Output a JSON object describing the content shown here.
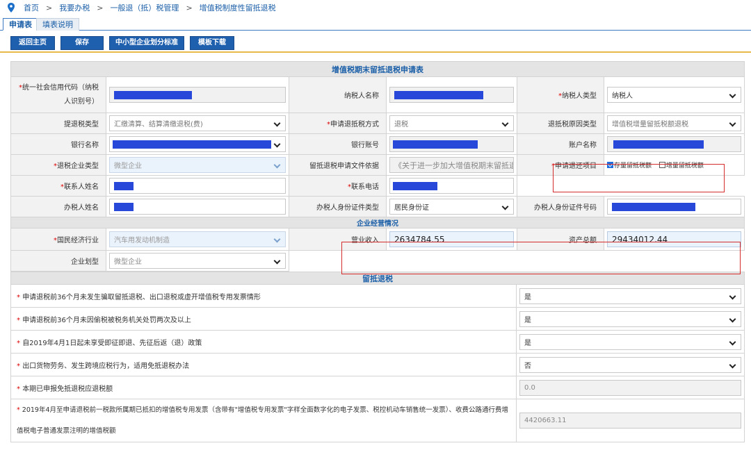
{
  "breadcrumb": {
    "items": [
      "首页",
      "我要办税",
      "一般退（抵）税管理",
      "增值税制度性留抵退税"
    ],
    "sep": ">"
  },
  "tabs": [
    "申请表",
    "填表说明"
  ],
  "toolbar": {
    "back": "返回主页",
    "save": "保存",
    "standard": "中小型企业划分标准",
    "template": "模板下载"
  },
  "form": {
    "title": "增值税期末留抵退税申请表",
    "credit_code_label": "统一社会信用代码（纳税人识别号）",
    "taxpayer_name_label": "纳税人名称",
    "taxpayer_type_label": "纳税人类型",
    "taxpayer_type_value": "纳税人",
    "refund_tax_type_label": "提退税类型",
    "refund_tax_type_value": "汇缴清算、结算清缴退税(费)",
    "refund_method_label": "申请退抵税方式",
    "refund_method_value": "退税",
    "refund_reason_label": "退抵税原因类型",
    "refund_reason_value": "增值税增量留抵税额退税",
    "bank_name_label": "银行名称",
    "bank_account_label": "银行账号",
    "account_name_label": "账户名称",
    "enterprise_type_label": "退税企业类型",
    "enterprise_type_value": "微型企业",
    "doc_basis_label": "留抵退税申请文件依据",
    "doc_basis_value": "《关于进一步加大增值税期末留抵退",
    "refund_item_label": "申请退还项目",
    "refund_item_opt1": "存量留抵税额",
    "refund_item_opt2": "增量留抵税额",
    "contact_name_label": "联系人姓名",
    "contact_phone_label": "联系电话",
    "handler_name_label": "办税人姓名",
    "handler_id_type_label": "办税人身份证件类型",
    "handler_id_type_value": "居民身份证",
    "handler_id_no_label": "办税人身份证件号码",
    "section_business": "企业经营情况",
    "industry_label": "国民经济行业",
    "industry_value": "汽车用发动机制造",
    "revenue_label": "营业收入",
    "revenue_value": "2634784.55",
    "assets_label": "资产总额",
    "assets_value": "29434012.44",
    "scale_label": "企业划型",
    "scale_value": "微型企业",
    "section_refund": "留抵退税",
    "q1": "申请退税前36个月未发生骗取留抵退税、出口退税或虚开增值税专用发票情形",
    "q1_value": "是",
    "q2": "申请退税前36个月未因偷税被税务机关处罚两次及以上",
    "q2_value": "是",
    "q3": "自2019年4月1日起未享受即征即退、先征后返（退）政策",
    "q3_value": "是",
    "q4": "出口货物劳务、发生跨境应税行为，适用免抵退税办法",
    "q4_value": "否",
    "q5": "本期已申报免抵退税应退税额",
    "q5_value": "0.0",
    "q6_line1": "2019年4月至申请退税前一税款所属期已抵扣的增值税专用发票（含带有\"增值税专用发票\"字样全面数字化的电子发票、税控机动车销售统一发票）、收费公路通行费增",
    "q6_line2": "值税电子普通发票注明的增值税额",
    "q6_value": "4420663.11"
  },
  "colors": {
    "accent": "#1e5fae",
    "required": "#dd0000",
    "highlight_box": "#d42b2b",
    "redaction": "#2748d8"
  }
}
